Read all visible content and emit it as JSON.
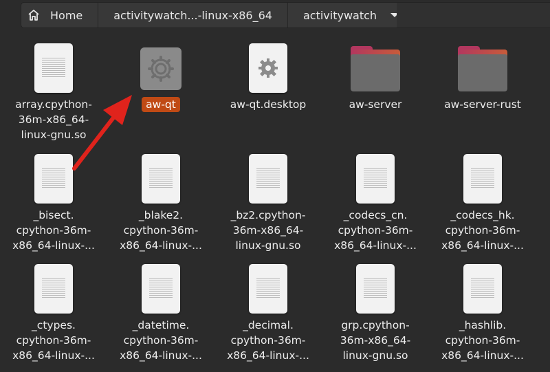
{
  "breadcrumb": {
    "home_label": "Home",
    "middle_label": "activitywatch...-linux-x86_64",
    "current_label": "activitywatch"
  },
  "files": [
    {
      "name": "array.cpython-\n36m-x86_64-\nlinux-gnu.so",
      "icon": "document-icon"
    },
    {
      "name": "aw-qt",
      "icon": "executable-gear-icon",
      "selected": true
    },
    {
      "name": "aw-qt.desktop",
      "icon": "desktop-file-gear-icon"
    },
    {
      "name": "aw-server",
      "icon": "folder-icon"
    },
    {
      "name": "aw-server-rust",
      "icon": "folder-icon"
    },
    {
      "name": "_bisect.\ncpython-36m-\nx86_64-linux-...",
      "icon": "document-icon"
    },
    {
      "name": "_blake2.\ncpython-36m-\nx86_64-linux-...",
      "icon": "document-icon"
    },
    {
      "name": "_bz2.cpython-\n36m-x86_64-\nlinux-gnu.so",
      "icon": "document-icon"
    },
    {
      "name": "_codecs_cn.\ncpython-36m-\nx86_64-linux-...",
      "icon": "document-icon"
    },
    {
      "name": "_codecs_hk.\ncpython-36m-\nx86_64-linux-...",
      "icon": "document-icon"
    },
    {
      "name": "_ctypes.\ncpython-36m-\nx86_64-linux-...",
      "icon": "document-icon"
    },
    {
      "name": "_datetime.\ncpython-36m-\nx86_64-linux-...",
      "icon": "document-icon"
    },
    {
      "name": "_decimal.\ncpython-36m-\nx86_64-linux-...",
      "icon": "document-icon"
    },
    {
      "name": "grp.cpython-\n36m-x86_64-\nlinux-gnu.so",
      "icon": "document-icon"
    },
    {
      "name": "_hashlib.\ncpython-36m-\nx86_64-linux-...",
      "icon": "document-icon"
    }
  ],
  "colors": {
    "background": "#2b2b2b",
    "selection": "#c04a15",
    "annotation_arrow": "#e0231c",
    "folder_accent": "#b2375f"
  }
}
